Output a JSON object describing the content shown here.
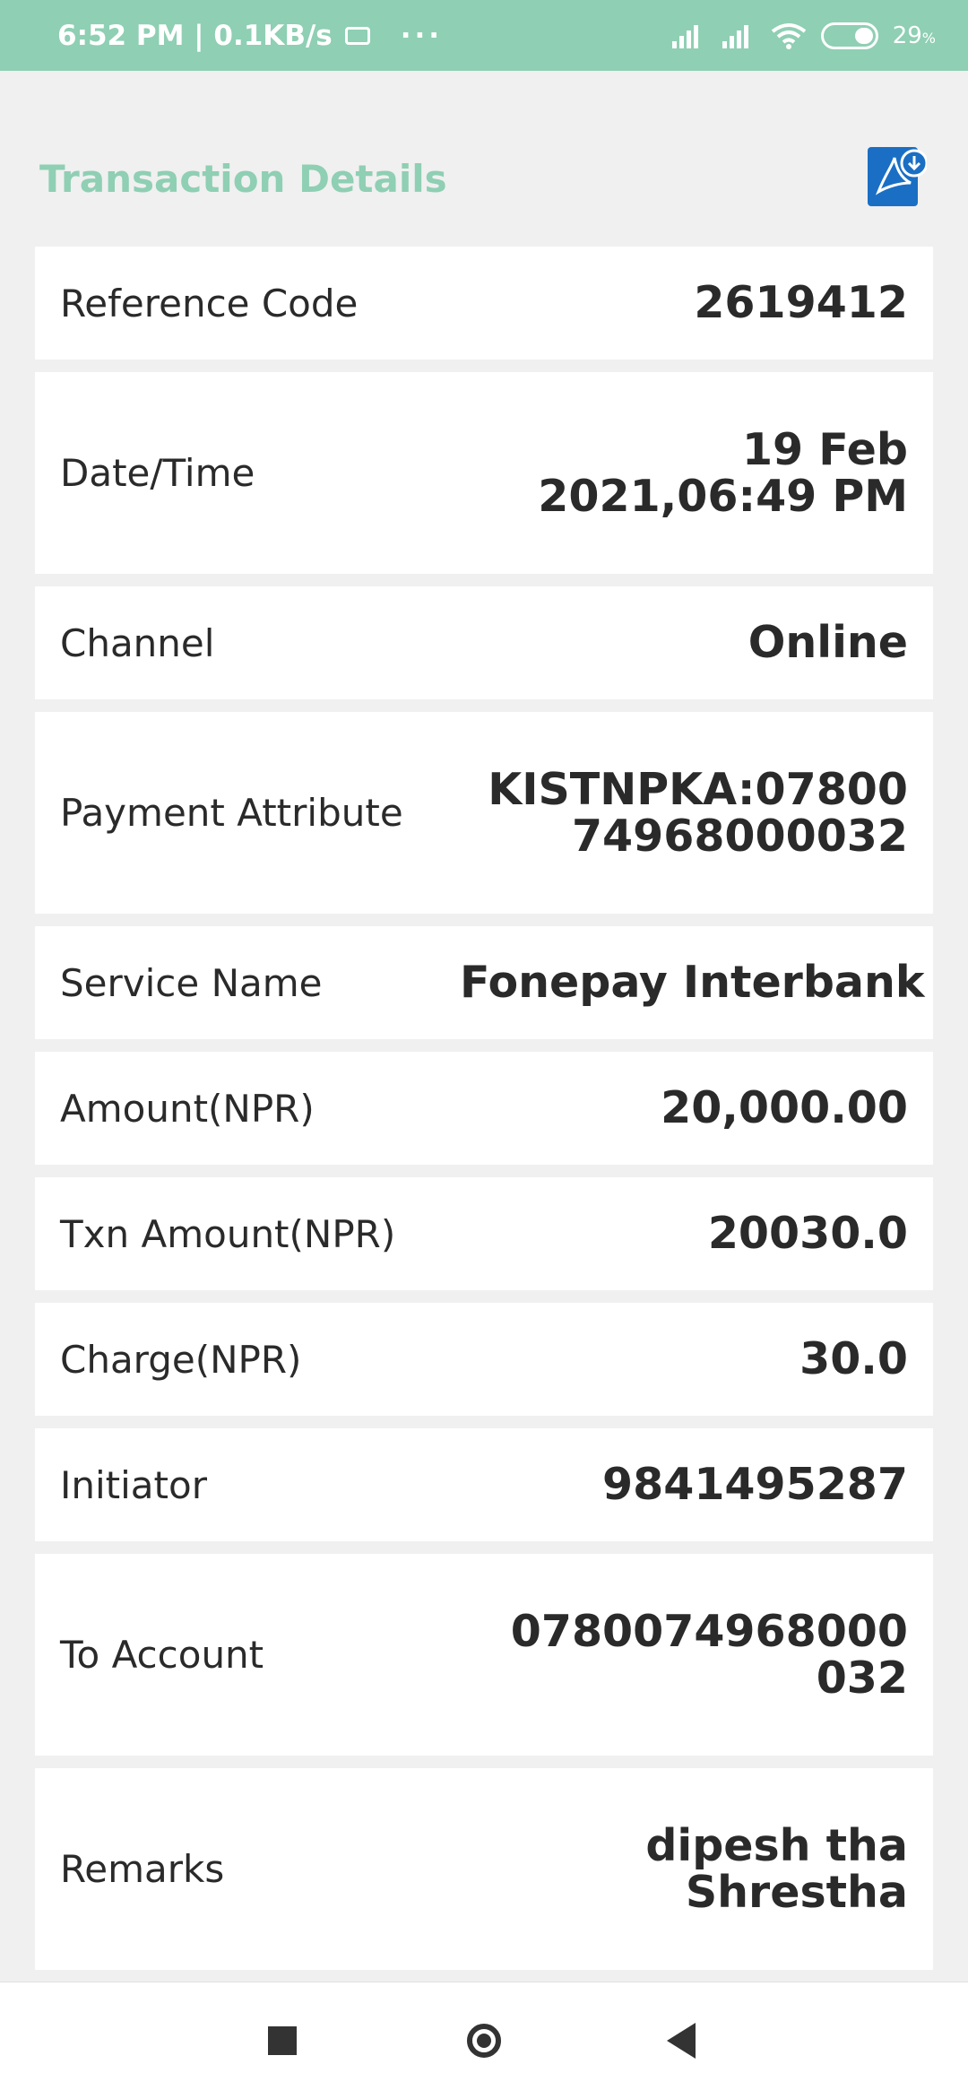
{
  "status_bar": {
    "time_speed": "6:52 PM | 0.1KB/s",
    "dots": "···",
    "battery": "29",
    "battery_unit": "%"
  },
  "header": {
    "title": "Transaction Details",
    "pdf_icon": "pdf-download-icon"
  },
  "details": [
    {
      "label": "Reference Code",
      "value": "2619412"
    },
    {
      "label": "Date/Time",
      "value": "19 Feb 2021,06:49 PM"
    },
    {
      "label": "Channel",
      "value": "Online"
    },
    {
      "label": "Payment Attribute",
      "value": "KISTNPKA:0780074968000032"
    },
    {
      "label": "Service Name",
      "value": "Fonepay Interbank"
    },
    {
      "label": "Amount(NPR)",
      "value": "20,000.00"
    },
    {
      "label": "Txn Amount(NPR)",
      "value": "20030.0"
    },
    {
      "label": "Charge(NPR)",
      "value": "30.0"
    },
    {
      "label": "Initiator",
      "value": "9841495287"
    },
    {
      "label": "To Account",
      "value": "0780074968000032"
    },
    {
      "label": "Remarks",
      "value": "dipesh tha Shrestha"
    }
  ],
  "colors": {
    "accent": "#8fcfb4",
    "pdf_blue": "#1a6fc4",
    "background": "#f0f0f0"
  },
  "nav": {
    "recents_icon": "square-icon",
    "home_icon": "circle-icon",
    "back_icon": "triangle-back-icon"
  }
}
